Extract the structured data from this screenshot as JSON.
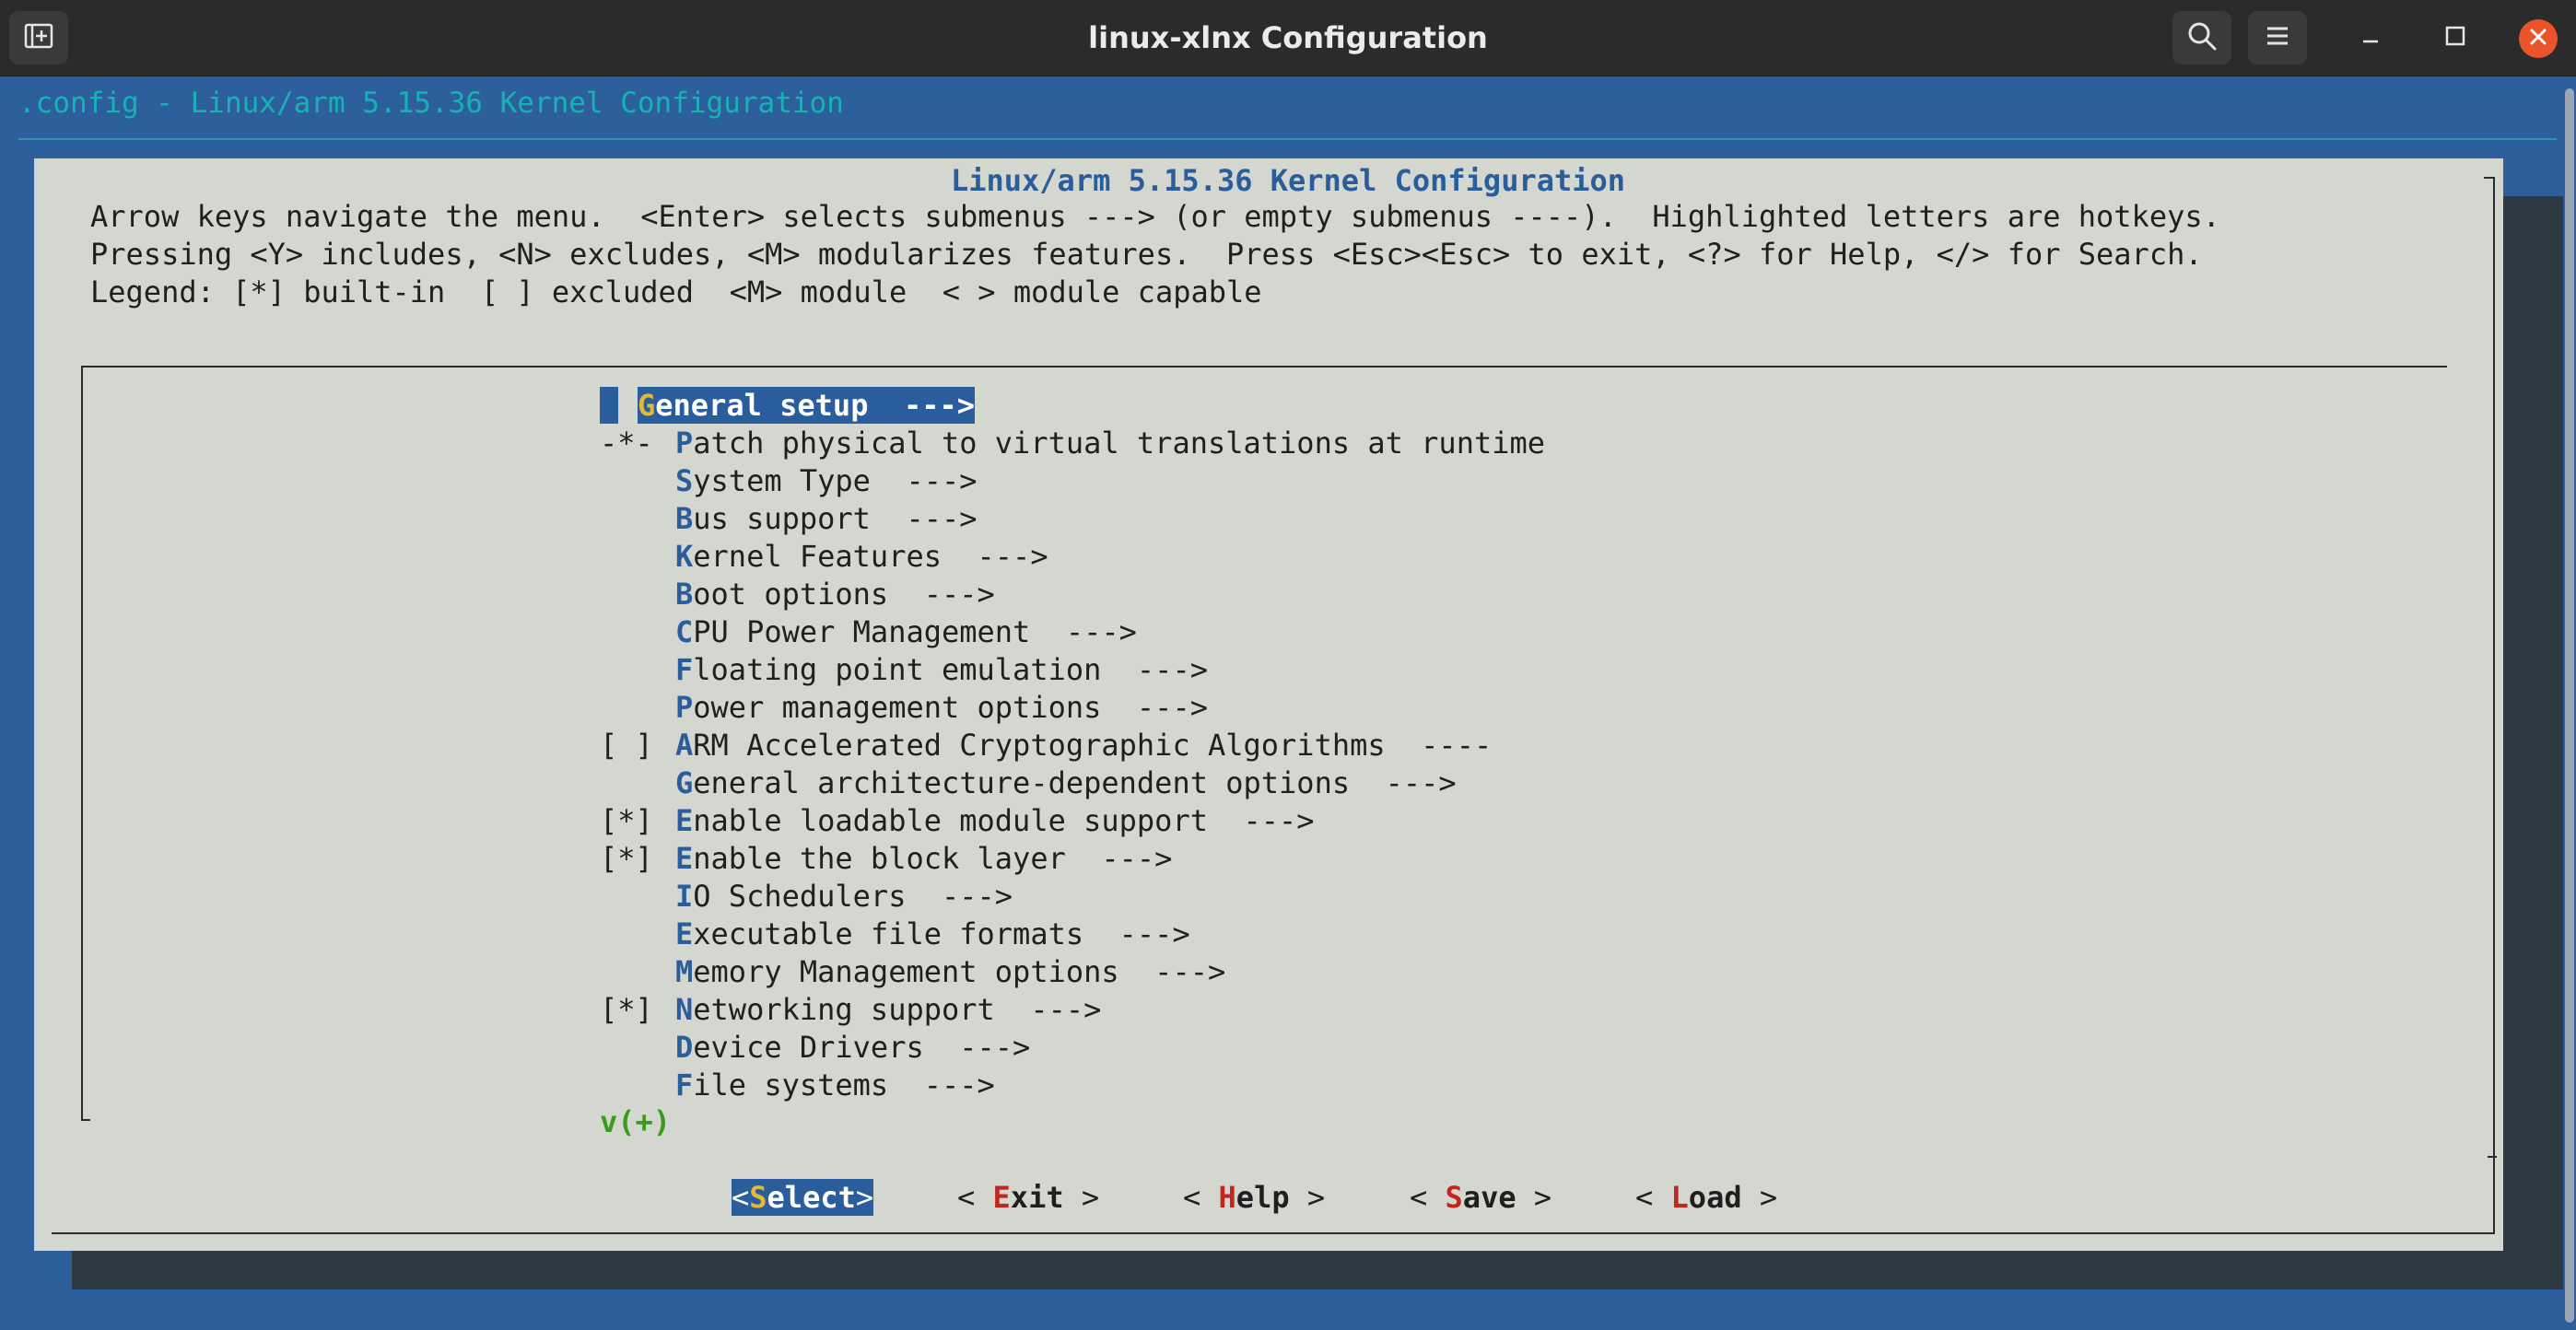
{
  "window": {
    "title": "linux-xlnx Configuration"
  },
  "terminal": {
    "backtitle": ".config - Linux/arm 5.15.36 Kernel Configuration",
    "dialog_title": "Linux/arm 5.15.36 Kernel Configuration",
    "help_lines": [
      "Arrow keys navigate the menu.  <Enter> selects submenus ---> (or empty submenus ----).  Highlighted letters are hotkeys.",
      "Pressing <Y> includes, <N> excludes, <M> modularizes features.  Press <Esc><Esc> to exit, <?> for Help, </> for Search.",
      "Legend: [*] built-in  [ ] excluded  <M> module  < > module capable"
    ],
    "menu_items": [
      {
        "prefix": "",
        "hotkey": "G",
        "rest": "eneral setup  --->",
        "selected": true
      },
      {
        "prefix": "-*-",
        "hotkey": "P",
        "rest": "atch physical to virtual translations at runtime"
      },
      {
        "prefix": "",
        "hotkey": "S",
        "rest": "ystem Type  --->"
      },
      {
        "prefix": "",
        "hotkey": "B",
        "rest": "us support  --->"
      },
      {
        "prefix": "",
        "hotkey": "K",
        "rest": "ernel Features  --->"
      },
      {
        "prefix": "",
        "hotkey": "B",
        "rest": "oot options  --->"
      },
      {
        "prefix": "",
        "hotkey": "C",
        "rest": "PU Power Management  --->"
      },
      {
        "prefix": "",
        "hotkey": "F",
        "rest": "loating point emulation  --->"
      },
      {
        "prefix": "",
        "hotkey": "P",
        "rest": "ower management options  --->"
      },
      {
        "prefix": "[ ]",
        "hotkey": "A",
        "rest": "RM Accelerated Cryptographic Algorithms  ----"
      },
      {
        "prefix": "",
        "hotkey": "G",
        "rest": "eneral architecture-dependent options  --->"
      },
      {
        "prefix": "[*]",
        "hotkey": "E",
        "rest": "nable loadable module support  --->"
      },
      {
        "prefix": "[*]",
        "hotkey": "E",
        "rest": "nable the block layer  --->"
      },
      {
        "prefix": "",
        "hotkey": "I",
        "rest": "O Schedulers  --->"
      },
      {
        "prefix": "",
        "hotkey": "E",
        "rest": "xecutable file formats  --->"
      },
      {
        "prefix": "",
        "hotkey": "M",
        "rest": "emory Management options  --->",
        "hotkey2": "e"
      },
      {
        "prefix": "[*]",
        "hotkey": "N",
        "rest": "etworking support  --->",
        "hotkey2": "e"
      },
      {
        "prefix": "",
        "hotkey": "D",
        "rest": "evice Drivers  --->"
      },
      {
        "prefix": "",
        "hotkey": "F",
        "rest": "ile systems  --->"
      }
    ],
    "more_indicator": "v(+)",
    "buttons": [
      {
        "open": "<",
        "hotkey": "S",
        "rest": "elect",
        "close": ">",
        "active": true
      },
      {
        "open": "< ",
        "hotkey": "E",
        "rest": "xit",
        "close": " >"
      },
      {
        "open": "< ",
        "hotkey": "H",
        "rest": "elp",
        "close": " >"
      },
      {
        "open": "< ",
        "hotkey": "S",
        "rest": "ave",
        "close": " >"
      },
      {
        "open": "< ",
        "hotkey": "L",
        "rest": "oad",
        "close": " >"
      }
    ]
  },
  "icons": {
    "new_tab": "new-tab-icon",
    "search": "search-icon",
    "menu": "hamburger-menu-icon",
    "minimize": "minimize-icon",
    "maximize": "maximize-icon",
    "close": "close-icon"
  },
  "colors": {
    "terminal_bg": "#2d5f9c",
    "dialog_bg": "#d4d7d0",
    "highlight": "#2a5d9b",
    "hotkey_selected": "#e0b93a",
    "button_hotkey": "#c2261e",
    "more_indicator": "#3a9b1f",
    "close_button": "#e9542b"
  }
}
